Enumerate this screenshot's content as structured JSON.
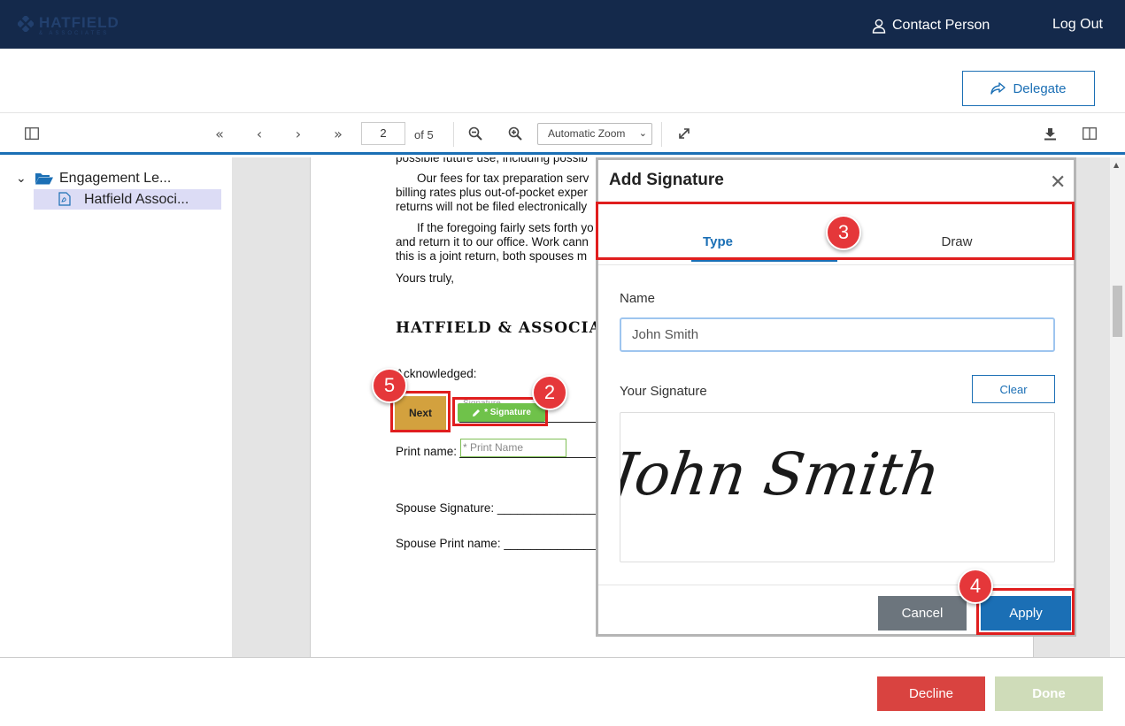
{
  "header": {
    "logo_text": "HATFIELD",
    "logo_sub": "& ASSOCIATES",
    "contact_label": "Contact Person",
    "logout_label": "Log Out"
  },
  "actions": {
    "delegate_label": "Delegate"
  },
  "toolbar": {
    "current_page": "2",
    "page_total_label": "of 5",
    "zoom_value": "Automatic Zoom"
  },
  "sidebar": {
    "folder_label": "Engagement Le...",
    "file_label": "Hatfield Associ..."
  },
  "document": {
    "lines": [
      "possible future use, including possib",
      "Our fees for tax preparation serv",
      "billing rates plus out-of-pocket exper",
      "returns will not be filed electronically",
      "If the foregoing fairly sets forth yo",
      "and return it to our office. Work cann",
      "this is a joint return, both spouses m",
      "Yours truly,"
    ],
    "firm_name": "HATFIELD & ASSOCIAT",
    "acknowledged": "Acknowledged:",
    "next_tag": "Next",
    "signature_tag": "* Signature",
    "signature_hint": "Signature",
    "print_name_label": "Print name:",
    "print_name_placeholder": "* Print Name",
    "spouse_signature": "Spouse Signature: ___________________",
    "spouse_print_name": "Spouse Print name: _________________"
  },
  "modal": {
    "title": "Add Signature",
    "tab_type": "Type",
    "tab_draw": "Draw",
    "name_label": "Name",
    "name_value": "John Smith",
    "signature_label": "Your Signature",
    "clear_label": "Clear",
    "signature_text": "John Smith",
    "cancel_label": "Cancel",
    "apply_label": "Apply"
  },
  "footer": {
    "decline_label": "Decline",
    "done_label": "Done"
  },
  "annotations": {
    "step2": "2",
    "step3": "3",
    "step4": "4",
    "step5": "5"
  },
  "colors": {
    "header_bg": "#14294b",
    "accent": "#1b6fb5",
    "decline": "#d94340",
    "done_disabled": "#cfdcb9",
    "next_tag": "#d3a13e",
    "signature_tag": "#6fc24a",
    "callout_red": "#e01e1e"
  }
}
